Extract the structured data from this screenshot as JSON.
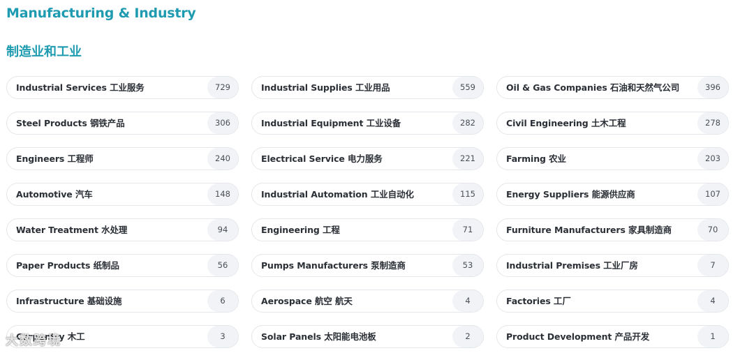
{
  "heading": {
    "title_en": "Manufacturing & Industry",
    "title_zh": "制造业和工业"
  },
  "categories": [
    {
      "label": "Industrial Services  工业服务",
      "count": "729"
    },
    {
      "label": "Industrial Supplies  工业用品",
      "count": "559"
    },
    {
      "label": "Oil & Gas Companies  石油和天然气公司",
      "count": "396"
    },
    {
      "label": "Steel Products  钢铁产品",
      "count": "306"
    },
    {
      "label": "Industrial Equipment  工业设备",
      "count": "282"
    },
    {
      "label": "Civil Engineering  土木工程",
      "count": "278"
    },
    {
      "label": "Engineers  工程师",
      "count": "240"
    },
    {
      "label": "Electrical Service  电力服务",
      "count": "221"
    },
    {
      "label": "Farming  农业",
      "count": "203"
    },
    {
      "label": "Automotive  汽车",
      "count": "148"
    },
    {
      "label": "Industrial Automation  工业自动化",
      "count": "115"
    },
    {
      "label": "Energy Suppliers  能源供应商",
      "count": "107"
    },
    {
      "label": "Water Treatment  水处理",
      "count": "94"
    },
    {
      "label": "Engineering  工程",
      "count": "71"
    },
    {
      "label": "Furniture Manufacturers  家具制造商",
      "count": "70"
    },
    {
      "label": "Paper Products  纸制品",
      "count": "56"
    },
    {
      "label": "Pumps Manufacturers  泵制造商",
      "count": "53"
    },
    {
      "label": "Industrial Premises  工业厂房",
      "count": "7"
    },
    {
      "label": "Infrastructure  基础设施",
      "count": "6"
    },
    {
      "label": "Aerospace  航空 航天",
      "count": "4"
    },
    {
      "label": "Factories  工厂",
      "count": "4"
    },
    {
      "label": "Carpentry  木工",
      "count": "3"
    },
    {
      "label": "Solar Panels  太阳能电池板",
      "count": "2"
    },
    {
      "label": "Product Development  产品开发",
      "count": "1"
    }
  ],
  "watermark": "大数跨境"
}
